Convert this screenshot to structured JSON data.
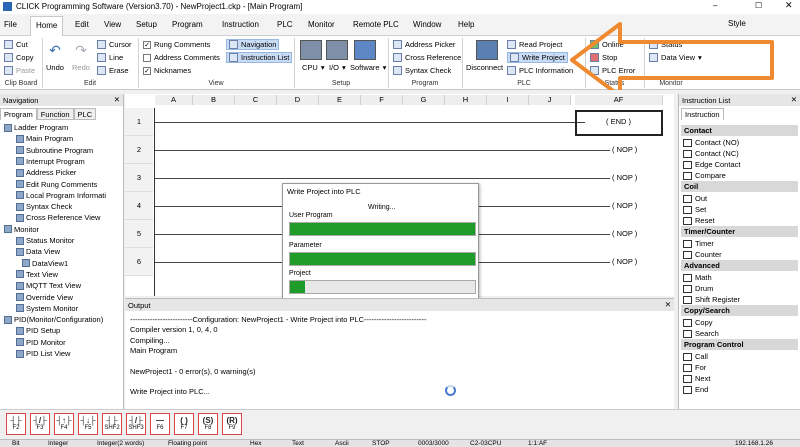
{
  "window": {
    "title": "CLICK Programming Software (Version3.70) - NewProject1.ckp - [Main Program]",
    "style_label": "Style"
  },
  "menu": [
    "File",
    "Home",
    "Edit",
    "View",
    "Setup",
    "Program",
    "Instruction",
    "PLC",
    "Monitor",
    "Remote PLC",
    "Window",
    "Help"
  ],
  "ribbon": {
    "clipboard": {
      "cut": "Cut",
      "copy": "Copy",
      "paste": "Paste",
      "group": "Clip Board"
    },
    "edit": {
      "undo": "Undo",
      "redo": "Redo",
      "cursor": "Cursor",
      "line": "Line",
      "erase": "Erase",
      "group": "Edit"
    },
    "view": {
      "rung_comments": "Rung Comments",
      "address_comments": "Address Comments",
      "nicknames": "Nicknames",
      "navigation": "Navigation",
      "instruction_list": "Instruction List",
      "group": "View"
    },
    "setup": {
      "cpu": "CPU",
      "io": "I/O",
      "software": "Software",
      "group": "Setup"
    },
    "program": {
      "address_picker": "Address Picker",
      "cross_reference": "Cross Reference",
      "syntax_check": "Syntax Check",
      "group": "Program"
    },
    "plc": {
      "disconnect": "Disconnect",
      "read_project": "Read Project",
      "write_project": "Write Project",
      "plc_information": "PLC Information",
      "group": "PLC"
    },
    "status": {
      "online": "Online",
      "stop": "Stop",
      "plc_error": "PLC Error",
      "group": "Status"
    },
    "monitor": {
      "status": "Status",
      "data_view": "Data View",
      "group": "Monitor"
    }
  },
  "navigation": {
    "title": "Navigation",
    "tabs": [
      "Program",
      "Function",
      "PLC"
    ],
    "tree": [
      {
        "label": "Ladder Program",
        "level": 0
      },
      {
        "label": "Main Program",
        "level": 2
      },
      {
        "label": "Subroutine Program",
        "level": 2
      },
      {
        "label": "Interrupt Program",
        "level": 2
      },
      {
        "label": "Address Picker",
        "level": 2
      },
      {
        "label": "Edit Rung Comments",
        "level": 2
      },
      {
        "label": "Local Program Informati",
        "level": 2
      },
      {
        "label": "Syntax Check",
        "level": 2
      },
      {
        "label": "Cross Reference View",
        "level": 2
      },
      {
        "label": "Monitor",
        "level": 0
      },
      {
        "label": "Status Monitor",
        "level": 2
      },
      {
        "label": "Data View",
        "level": 2
      },
      {
        "label": "DataView1",
        "level": 3
      },
      {
        "label": "Text View",
        "level": 2
      },
      {
        "label": "MQTT Text View",
        "level": 2
      },
      {
        "label": "Override View",
        "level": 2
      },
      {
        "label": "System Monitor",
        "level": 2
      },
      {
        "label": "PID(Monitor/Configuration)",
        "level": 0
      },
      {
        "label": "PID Setup",
        "level": 2
      },
      {
        "label": "PID Monitor",
        "level": 2
      },
      {
        "label": "PID List View",
        "level": 2
      }
    ]
  },
  "ladder": {
    "columns": [
      "A",
      "B",
      "C",
      "D",
      "E",
      "F",
      "G",
      "H",
      "I",
      "J",
      "AF"
    ],
    "rungs": [
      "1",
      "2",
      "3",
      "4",
      "5",
      "6"
    ],
    "coils": [
      "END",
      "NOP",
      "NOP",
      "NOP",
      "NOP",
      "NOP"
    ]
  },
  "dialog": {
    "title": "Write Project into PLC",
    "status": "Writing...",
    "labels": [
      "User Program",
      "Parameter",
      "Project"
    ],
    "progress": [
      1.0,
      1.0,
      0.08
    ]
  },
  "output": {
    "title": "Output",
    "lines": [
      "-------------------------Configuration: NewProject1 - Write Project into PLC-------------------------",
      "Compiler version 1, 0, 4, 0",
      "Compiling...",
      "Main Program",
      "",
      "NewProject1 - 0 error(s), 0 warning(s)",
      "",
      "Write Project into PLC..."
    ]
  },
  "instruction_list": {
    "title": "Instruction List",
    "tab": "Instruction",
    "sections": [
      {
        "name": "Contact",
        "items": [
          "Contact (NO)",
          "Contact (NC)",
          "Edge Contact",
          "Compare"
        ]
      },
      {
        "name": "Coil",
        "items": [
          "Out",
          "Set",
          "Reset"
        ]
      },
      {
        "name": "Timer/Counter",
        "items": [
          "Timer",
          "Counter"
        ]
      },
      {
        "name": "Advanced",
        "items": [
          "Math",
          "Drum",
          "Shift Register"
        ]
      },
      {
        "name": "Copy/Search",
        "items": [
          "Copy",
          "Search"
        ]
      },
      {
        "name": "Program Control",
        "items": [
          "Call",
          "For",
          "Next",
          "End"
        ]
      }
    ]
  },
  "fkeys": [
    "F2",
    "F3",
    "F4",
    "F5",
    "SHF2",
    "SHF3",
    "F6",
    "F7",
    "F8",
    "F9"
  ],
  "statusbar": [
    "Bit",
    "Integer",
    "Integer(2 words)",
    "Floating point",
    "Hex",
    "Text",
    "Ascii",
    "STOP",
    "0003/3000",
    "C2-03CPU",
    "1:1:AF",
    "192.168.1.26"
  ],
  "colors": {
    "accent": "#1e9b28",
    "arrow": "#f08a30"
  }
}
